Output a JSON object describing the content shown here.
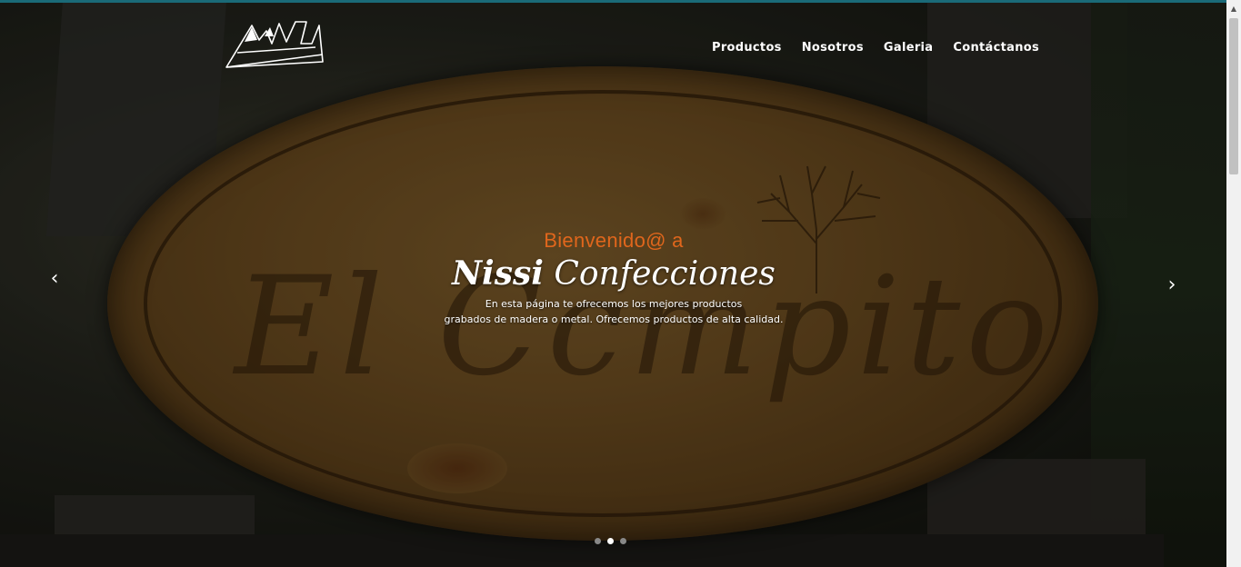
{
  "nav": {
    "logo_text": "NISSI",
    "items": [
      {
        "label": "Productos"
      },
      {
        "label": "Nosotros"
      },
      {
        "label": "Galeria"
      },
      {
        "label": "Contáctanos"
      }
    ]
  },
  "carousel": {
    "kicker": "Bienvenido@ a",
    "title_bold": "Nissi",
    "title_rest": "Confecciones",
    "text_line1": "En esta página te ofrecemos los mejores productos",
    "text_line2": "grabados de madera o metal. Ofrecemos productos de alta calidad.",
    "sign_engraving": "El Ccmpito",
    "prev_icon": "‹",
    "next_icon": "›",
    "indicator_count": 3,
    "active_index": 1
  },
  "colors": {
    "accent": "#e0661c",
    "topline": "#1a6a78"
  },
  "icons": {
    "prev": "chevron-left-icon",
    "next": "chevron-right-icon"
  }
}
